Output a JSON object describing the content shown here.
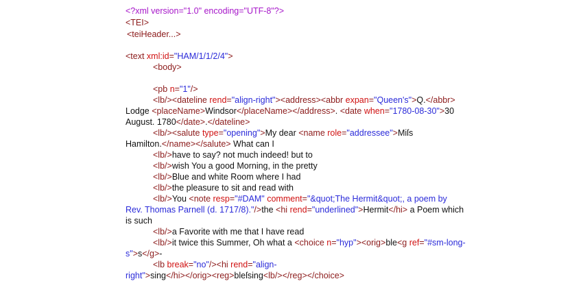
{
  "colors": {
    "pi": "#a616c9",
    "tag": "#8b1a1a",
    "attr": "#d01010",
    "val": "#2b2bd9",
    "text": "#111111"
  },
  "lines": [
    [
      [
        "pi",
        "<?xml  version=\"1.0\"  encoding=\"UTF-8\"?>"
      ]
    ],
    [
      [
        "tag",
        "<TEI>"
      ]
    ],
    [
      [
        "tag",
        "<teiHeader...>"
      ]
    ],
    [],
    [
      [
        "tag",
        "<text "
      ],
      [
        "attr",
        "xml:id"
      ],
      [
        "tag",
        "="
      ],
      [
        "val",
        "\"HAM/1/1/2/4\""
      ],
      [
        "tag",
        ">"
      ]
    ],
    [
      [
        "tag",
        "<body>"
      ]
    ],
    [],
    [
      [
        "tag",
        "<pb "
      ],
      [
        "attr",
        "n"
      ],
      [
        "tag",
        "="
      ],
      [
        "val",
        "\"1\""
      ],
      [
        "tag",
        "/>"
      ]
    ],
    [
      [
        "tag",
        "<lb/><dateline "
      ],
      [
        "attr",
        "rend"
      ],
      [
        "tag",
        "="
      ],
      [
        "val",
        "\"align-right\""
      ],
      [
        "tag",
        "><address><abbr "
      ],
      [
        "attr",
        "expan"
      ],
      [
        "tag",
        "="
      ],
      [
        "val",
        "\"Queen's\""
      ],
      [
        "tag",
        ">"
      ],
      [
        "text",
        "Q."
      ],
      [
        "tag",
        "</abbr>"
      ]
    ],
    [
      [
        "text",
        "Lodge "
      ],
      [
        "tag",
        "<placeName>"
      ],
      [
        "text",
        "Windsor"
      ],
      [
        "tag",
        "</placeName></address>"
      ],
      [
        "text",
        ". "
      ],
      [
        "tag",
        "<date "
      ],
      [
        "attr",
        "when"
      ],
      [
        "tag",
        "="
      ],
      [
        "val",
        "\"1780-08-30\""
      ],
      [
        "tag",
        ">"
      ],
      [
        "text",
        "30"
      ]
    ],
    [
      [
        "text",
        "August. 1780"
      ],
      [
        "tag",
        "</date>"
      ],
      [
        "text",
        "."
      ],
      [
        "tag",
        "</dateline>"
      ]
    ],
    [
      [
        "tag",
        "<lb/><salute "
      ],
      [
        "attr",
        "type"
      ],
      [
        "tag",
        "="
      ],
      [
        "val",
        "\"opening\""
      ],
      [
        "tag",
        ">"
      ],
      [
        "text",
        "My dear "
      ],
      [
        "tag",
        "<name "
      ],
      [
        "attr",
        "role"
      ],
      [
        "tag",
        "="
      ],
      [
        "val",
        "\"addressee\""
      ],
      [
        "tag",
        ">"
      ],
      [
        "text",
        "Miſs"
      ]
    ],
    [
      [
        "text",
        "Hamilton."
      ],
      [
        "tag",
        "</name></salute>"
      ],
      [
        "text",
        " What can I"
      ]
    ],
    [
      [
        "tag",
        "<lb/>"
      ],
      [
        "text",
        "have to say? not much indeed! but to"
      ]
    ],
    [
      [
        "tag",
        "<lb/>"
      ],
      [
        "text",
        "wish You a good Morning, in the pretty"
      ]
    ],
    [
      [
        "tag",
        "<lb/>"
      ],
      [
        "text",
        "Blue and white Room where I had"
      ]
    ],
    [
      [
        "tag",
        "<lb/>"
      ],
      [
        "text",
        "the pleasure to sit and read with"
      ]
    ],
    [
      [
        "tag",
        "<lb/>"
      ],
      [
        "text",
        "You "
      ],
      [
        "tag",
        "<note "
      ],
      [
        "attr",
        "resp"
      ],
      [
        "tag",
        "="
      ],
      [
        "val",
        "\"#DAM\""
      ],
      [
        "tag",
        " "
      ],
      [
        "attr",
        "comment"
      ],
      [
        "tag",
        "="
      ],
      [
        "val",
        "\"&quot;The Hermit&quot;, a poem by"
      ]
    ],
    [
      [
        "val",
        "Rev. Thomas Parnell (d. 1717/8).\""
      ],
      [
        "tag",
        "/>"
      ],
      [
        "text",
        "the "
      ],
      [
        "tag",
        "<hi "
      ],
      [
        "attr",
        "rend"
      ],
      [
        "tag",
        "="
      ],
      [
        "val",
        "\"underlined\""
      ],
      [
        "tag",
        ">"
      ],
      [
        "text",
        "Hermit"
      ],
      [
        "tag",
        "</hi>"
      ],
      [
        "text",
        " a Poem which"
      ]
    ],
    [
      [
        "text",
        "is such"
      ]
    ],
    [
      [
        "tag",
        "<lb/>"
      ],
      [
        "text",
        "a Favorite with me that I have read"
      ]
    ],
    [
      [
        "tag",
        "<lb/>"
      ],
      [
        "text",
        "it twice this Summer, Oh what a "
      ],
      [
        "tag",
        "<choice "
      ],
      [
        "attr",
        "n"
      ],
      [
        "tag",
        "="
      ],
      [
        "val",
        "\"hyp\""
      ],
      [
        "tag",
        "><orig>"
      ],
      [
        "text",
        "ble"
      ],
      [
        "tag",
        "<g "
      ],
      [
        "attr",
        "ref"
      ],
      [
        "tag",
        "="
      ],
      [
        "val",
        "\"#sm-long-"
      ]
    ],
    [
      [
        "val",
        "s\""
      ],
      [
        "tag",
        ">"
      ],
      [
        "text",
        "s"
      ],
      [
        "tag",
        "</g>"
      ],
      [
        "text",
        "-"
      ]
    ],
    [
      [
        "tag",
        "<lb "
      ],
      [
        "attr",
        "break"
      ],
      [
        "tag",
        "="
      ],
      [
        "val",
        "\"no\""
      ],
      [
        "tag",
        "/><hi "
      ],
      [
        "attr",
        "rend"
      ],
      [
        "tag",
        "="
      ],
      [
        "val",
        "\"align-"
      ]
    ],
    [
      [
        "val",
        "right\""
      ],
      [
        "tag",
        ">"
      ],
      [
        "text",
        "sing"
      ],
      [
        "tag",
        "</hi></orig><reg>"
      ],
      [
        "text",
        "bleſsing"
      ],
      [
        "tag",
        "<lb/></reg></choice>"
      ]
    ]
  ]
}
